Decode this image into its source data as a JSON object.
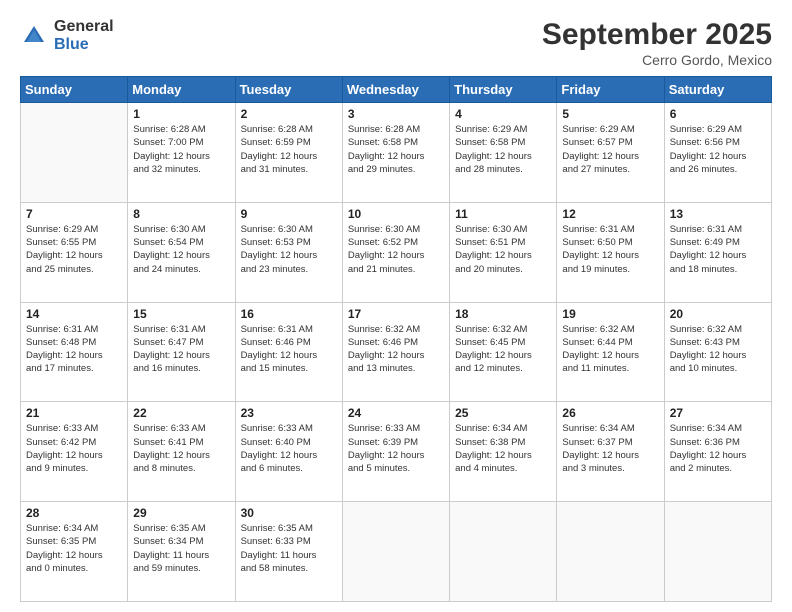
{
  "header": {
    "logo_general": "General",
    "logo_blue": "Blue",
    "title": "September 2025",
    "location": "Cerro Gordo, Mexico"
  },
  "days_of_week": [
    "Sunday",
    "Monday",
    "Tuesday",
    "Wednesday",
    "Thursday",
    "Friday",
    "Saturday"
  ],
  "weeks": [
    [
      {
        "day": "",
        "info": ""
      },
      {
        "day": "1",
        "info": "Sunrise: 6:28 AM\nSunset: 7:00 PM\nDaylight: 12 hours\nand 32 minutes."
      },
      {
        "day": "2",
        "info": "Sunrise: 6:28 AM\nSunset: 6:59 PM\nDaylight: 12 hours\nand 31 minutes."
      },
      {
        "day": "3",
        "info": "Sunrise: 6:28 AM\nSunset: 6:58 PM\nDaylight: 12 hours\nand 29 minutes."
      },
      {
        "day": "4",
        "info": "Sunrise: 6:29 AM\nSunset: 6:58 PM\nDaylight: 12 hours\nand 28 minutes."
      },
      {
        "day": "5",
        "info": "Sunrise: 6:29 AM\nSunset: 6:57 PM\nDaylight: 12 hours\nand 27 minutes."
      },
      {
        "day": "6",
        "info": "Sunrise: 6:29 AM\nSunset: 6:56 PM\nDaylight: 12 hours\nand 26 minutes."
      }
    ],
    [
      {
        "day": "7",
        "info": "Sunrise: 6:29 AM\nSunset: 6:55 PM\nDaylight: 12 hours\nand 25 minutes."
      },
      {
        "day": "8",
        "info": "Sunrise: 6:30 AM\nSunset: 6:54 PM\nDaylight: 12 hours\nand 24 minutes."
      },
      {
        "day": "9",
        "info": "Sunrise: 6:30 AM\nSunset: 6:53 PM\nDaylight: 12 hours\nand 23 minutes."
      },
      {
        "day": "10",
        "info": "Sunrise: 6:30 AM\nSunset: 6:52 PM\nDaylight: 12 hours\nand 21 minutes."
      },
      {
        "day": "11",
        "info": "Sunrise: 6:30 AM\nSunset: 6:51 PM\nDaylight: 12 hours\nand 20 minutes."
      },
      {
        "day": "12",
        "info": "Sunrise: 6:31 AM\nSunset: 6:50 PM\nDaylight: 12 hours\nand 19 minutes."
      },
      {
        "day": "13",
        "info": "Sunrise: 6:31 AM\nSunset: 6:49 PM\nDaylight: 12 hours\nand 18 minutes."
      }
    ],
    [
      {
        "day": "14",
        "info": "Sunrise: 6:31 AM\nSunset: 6:48 PM\nDaylight: 12 hours\nand 17 minutes."
      },
      {
        "day": "15",
        "info": "Sunrise: 6:31 AM\nSunset: 6:47 PM\nDaylight: 12 hours\nand 16 minutes."
      },
      {
        "day": "16",
        "info": "Sunrise: 6:31 AM\nSunset: 6:46 PM\nDaylight: 12 hours\nand 15 minutes."
      },
      {
        "day": "17",
        "info": "Sunrise: 6:32 AM\nSunset: 6:46 PM\nDaylight: 12 hours\nand 13 minutes."
      },
      {
        "day": "18",
        "info": "Sunrise: 6:32 AM\nSunset: 6:45 PM\nDaylight: 12 hours\nand 12 minutes."
      },
      {
        "day": "19",
        "info": "Sunrise: 6:32 AM\nSunset: 6:44 PM\nDaylight: 12 hours\nand 11 minutes."
      },
      {
        "day": "20",
        "info": "Sunrise: 6:32 AM\nSunset: 6:43 PM\nDaylight: 12 hours\nand 10 minutes."
      }
    ],
    [
      {
        "day": "21",
        "info": "Sunrise: 6:33 AM\nSunset: 6:42 PM\nDaylight: 12 hours\nand 9 minutes."
      },
      {
        "day": "22",
        "info": "Sunrise: 6:33 AM\nSunset: 6:41 PM\nDaylight: 12 hours\nand 8 minutes."
      },
      {
        "day": "23",
        "info": "Sunrise: 6:33 AM\nSunset: 6:40 PM\nDaylight: 12 hours\nand 6 minutes."
      },
      {
        "day": "24",
        "info": "Sunrise: 6:33 AM\nSunset: 6:39 PM\nDaylight: 12 hours\nand 5 minutes."
      },
      {
        "day": "25",
        "info": "Sunrise: 6:34 AM\nSunset: 6:38 PM\nDaylight: 12 hours\nand 4 minutes."
      },
      {
        "day": "26",
        "info": "Sunrise: 6:34 AM\nSunset: 6:37 PM\nDaylight: 12 hours\nand 3 minutes."
      },
      {
        "day": "27",
        "info": "Sunrise: 6:34 AM\nSunset: 6:36 PM\nDaylight: 12 hours\nand 2 minutes."
      }
    ],
    [
      {
        "day": "28",
        "info": "Sunrise: 6:34 AM\nSunset: 6:35 PM\nDaylight: 12 hours\nand 0 minutes."
      },
      {
        "day": "29",
        "info": "Sunrise: 6:35 AM\nSunset: 6:34 PM\nDaylight: 11 hours\nand 59 minutes."
      },
      {
        "day": "30",
        "info": "Sunrise: 6:35 AM\nSunset: 6:33 PM\nDaylight: 11 hours\nand 58 minutes."
      },
      {
        "day": "",
        "info": ""
      },
      {
        "day": "",
        "info": ""
      },
      {
        "day": "",
        "info": ""
      },
      {
        "day": "",
        "info": ""
      }
    ]
  ]
}
